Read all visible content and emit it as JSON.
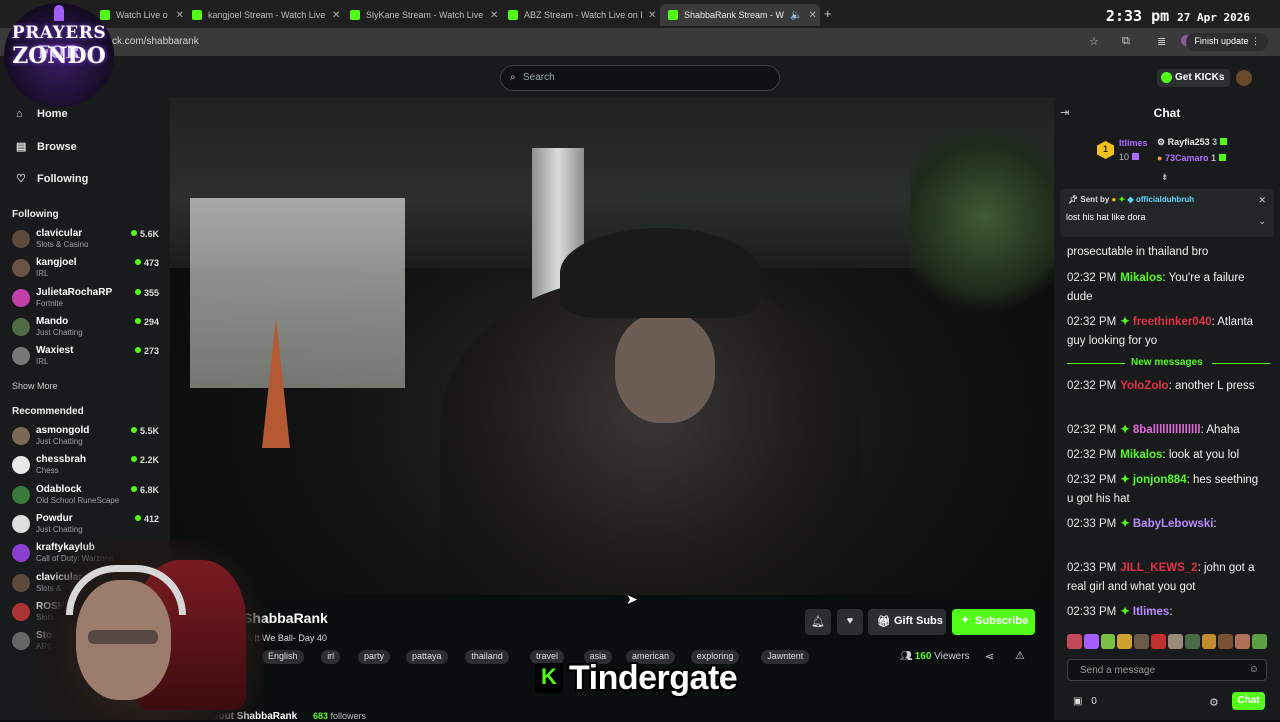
{
  "browser": {
    "tabs": [
      {
        "label": "Watch Live o",
        "active": false
      },
      {
        "label": "kangjoel Stream - Watch Live o",
        "active": false
      },
      {
        "label": "SlyKane Stream - Watch Live o",
        "active": false
      },
      {
        "label": "ABZ Stream - Watch Live on Ki",
        "active": false
      },
      {
        "label": "ShabbaRank Stream - Watc",
        "active": true
      }
    ],
    "url": "ck.com/shabbarank",
    "update_label": "Finish update",
    "clock_time": "2:33 pm",
    "clock_date": "27 Apr 2026"
  },
  "overlay_logo": {
    "line1": "PRAYERS FOR",
    "line2": "ZONDO"
  },
  "header": {
    "search_placeholder": "Search",
    "get_kicks_label": "Get KICKs"
  },
  "sidebar": {
    "nav": [
      {
        "label": "Home",
        "icon": "home-icon",
        "glyph": "⌂"
      },
      {
        "label": "Browse",
        "icon": "browse-icon",
        "glyph": "▤"
      },
      {
        "label": "Following",
        "icon": "heart-icon",
        "glyph": "♡"
      }
    ],
    "following_heading": "Following",
    "following": [
      {
        "name": "clavicular",
        "category": "Slots & Casino",
        "viewers": "5.6K",
        "color": "#5c4a3a"
      },
      {
        "name": "kangjoel",
        "category": "IRL",
        "viewers": "473",
        "color": "#6b5447"
      },
      {
        "name": "JulietaRochaRP",
        "category": "Fortnite",
        "viewers": "355",
        "color": "#c23fa8"
      },
      {
        "name": "Mando",
        "category": "Just Chatting",
        "viewers": "294",
        "color": "#4e6b43"
      },
      {
        "name": "Waxiest",
        "category": "IRL",
        "viewers": "273",
        "color": "#777777"
      }
    ],
    "show_more": "Show More",
    "recommended_heading": "Recommended",
    "recommended": [
      {
        "name": "asmongold",
        "category": "Just Chatting",
        "viewers": "5.5K",
        "color": "#7a6a55"
      },
      {
        "name": "chessbrah",
        "category": "Chess",
        "viewers": "2.2K",
        "color": "#e8e8e8"
      },
      {
        "name": "Odablock",
        "category": "Old School RuneScape",
        "viewers": "6.8K",
        "color": "#3a7a3a"
      },
      {
        "name": "Powdur",
        "category": "Just Chatting",
        "viewers": "412",
        "color": "#dddddd"
      },
      {
        "name": "kraftykaylub",
        "category": "Call of Duty: Warzone",
        "viewers": "",
        "color": "#8a3fd0"
      },
      {
        "name": "clavicular",
        "category": "Slots &",
        "viewers": "",
        "color": "#5c4a3a"
      },
      {
        "name": "ROSH",
        "category": "Slots",
        "viewers": "",
        "color": "#a33"
      },
      {
        "name": "Stone",
        "category": "ARC",
        "viewers": "",
        "color": "#666"
      }
    ]
  },
  "stream": {
    "streamer": "ShabbaRank",
    "title": "ck It We Ball- Day 40",
    "tags": [
      "English",
      "irl",
      "party",
      "pattaya",
      "thailand",
      "travel",
      "asia",
      "american",
      "exploring",
      "Jawntent"
    ],
    "gift_label": "Gift Subs",
    "subscribe_label": "Subscribe",
    "viewer_count": "160",
    "viewers_label": "Viewers",
    "about_label": "About ShabbaRank",
    "followers_count": "683",
    "followers_label": "followers",
    "overlay_caption": "Tindergate",
    "overlay_k": "K"
  },
  "chat": {
    "title": "Chat",
    "leaderboard": [
      {
        "name": "Itlimes",
        "count": "10",
        "color": "#ad6cff"
      },
      {
        "name": "Rayfia253",
        "count": "3",
        "color": "#ffffff"
      },
      {
        "name": "73Camaro",
        "count": "1",
        "color": "#ad6cff"
      }
    ],
    "rank_badge": "1",
    "pinned": {
      "sent_by_label": "Sent by",
      "user": "officialduhbruh",
      "message": "lost his hat like dora"
    },
    "messages": [
      {
        "time": "",
        "user": "",
        "color": "#ffffff",
        "text": "prosecutable in thailand bro",
        "gem": false
      },
      {
        "time": "02:32 PM",
        "user": "Mikalos",
        "color": "#53fc18",
        "text": "You're a failure dude",
        "gem": false
      },
      {
        "time": "02:32 PM",
        "user": "freethinker040",
        "color": "#e0304a",
        "text": "Atlanta guy looking for yo",
        "gem": true
      }
    ],
    "new_messages_label": "New messages",
    "messages_after": [
      {
        "time": "02:32 PM",
        "user": "YoloZolo",
        "color": "#e0304a",
        "text": "another L press",
        "gem": false
      },
      {
        "time": "02:32 PM",
        "user": "8balllllllllllllll",
        "color": "#e06ad8",
        "text": "Ahaha",
        "gem": true
      },
      {
        "time": "02:32 PM",
        "user": "Mikalos",
        "color": "#53fc18",
        "text": "look at you lol",
        "gem": false
      },
      {
        "time": "02:32 PM",
        "user": "jonjon884",
        "color": "#53fc18",
        "text": "hes seething u got his hat",
        "gem": true
      },
      {
        "time": "02:33 PM",
        "user": "BabyLebowski",
        "color": "#b88cff",
        "text": "",
        "gem": true
      },
      {
        "time": "02:33 PM",
        "user": "JILL_KEWS_2",
        "color": "#e0304a",
        "text": "john got a real girl and what you got",
        "gem": false
      },
      {
        "time": "02:33 PM",
        "user": "Itlimes",
        "color": "#b88cff",
        "text": "",
        "gem": true
      }
    ],
    "input_placeholder": "Send a message",
    "kicks_count": "0",
    "send_label": "Chat"
  }
}
